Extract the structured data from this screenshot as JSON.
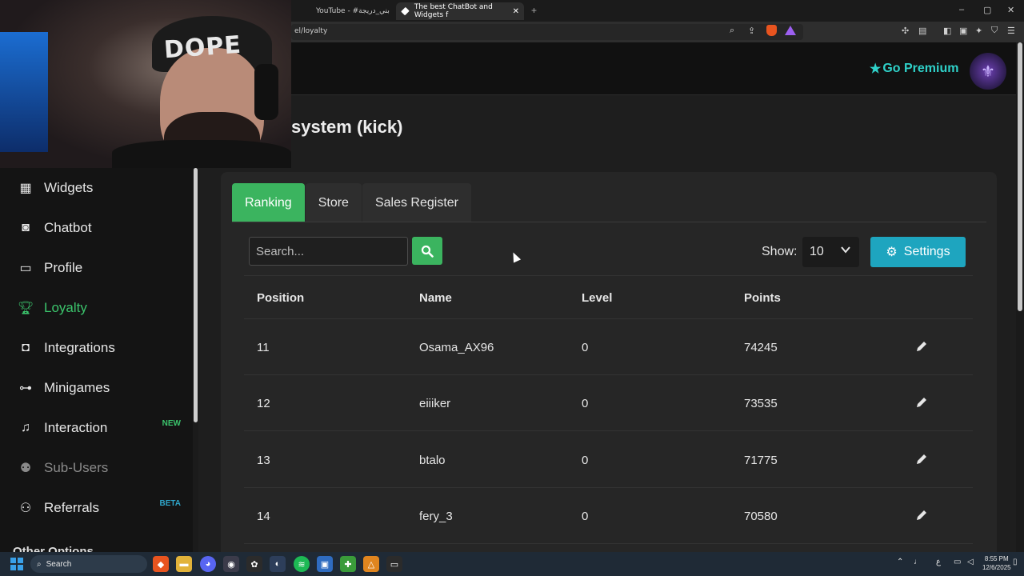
{
  "browser": {
    "tabs": [
      {
        "label": "YouTube - #بني_دريجة",
        "active": false
      },
      {
        "label": "The best ChatBot and Widgets f",
        "active": true
      }
    ],
    "tab_close": "✕",
    "new_tab": "+",
    "url": "el/loyalty",
    "window_controls": [
      "–",
      "▢",
      "✕"
    ]
  },
  "webcam": {
    "cap_text": "DOPE"
  },
  "header": {
    "premium_label": "Go Premium",
    "premium_icon": "star-icon",
    "accent": "#2fd1c9"
  },
  "page": {
    "title": "system (kick)"
  },
  "sidebar": {
    "items": [
      {
        "label": "Widgets",
        "icon": "grid-icon",
        "state": "normal"
      },
      {
        "label": "Chatbot",
        "icon": "robot-icon",
        "state": "normal"
      },
      {
        "label": "Profile",
        "icon": "id-card-icon",
        "state": "normal"
      },
      {
        "label": "Loyalty",
        "icon": "trophy-icon",
        "state": "active"
      },
      {
        "label": "Integrations",
        "icon": "discord-icon",
        "state": "normal"
      },
      {
        "label": "Minigames",
        "icon": "gamepad-icon",
        "state": "normal"
      },
      {
        "label": "Interaction",
        "icon": "music-icon",
        "state": "normal",
        "badge": "NEW"
      },
      {
        "label": "Sub-Users",
        "icon": "users-icon",
        "state": "disabled"
      },
      {
        "label": "Referrals",
        "icon": "people-icon",
        "state": "normal",
        "badge": "BETA"
      }
    ],
    "next_section": "Other Options",
    "active_color": "#3bc46c"
  },
  "tabs": [
    {
      "label": "Ranking",
      "active": true
    },
    {
      "label": "Store",
      "active": false
    },
    {
      "label": "Sales Register",
      "active": false
    }
  ],
  "toolbar": {
    "search_placeholder": "Search...",
    "show_label": "Show:",
    "show_value": "10",
    "settings_label": "Settings"
  },
  "table": {
    "columns": [
      "Position",
      "Name",
      "Level",
      "Points"
    ],
    "rows": [
      {
        "position": "11",
        "name": "Osama_AX96",
        "level": "0",
        "points": "74245"
      },
      {
        "position": "12",
        "name": "eiiiker",
        "level": "0",
        "points": "73535"
      },
      {
        "position": "13",
        "name": "btalo",
        "level": "0",
        "points": "71775"
      },
      {
        "position": "14",
        "name": "fery_3",
        "level": "0",
        "points": "70580"
      }
    ]
  },
  "taskbar": {
    "search_label": "Search",
    "tray_lang": "ع",
    "time": "8:55 PM",
    "date": "12/6/2025"
  },
  "colors": {
    "green": "#3bb45f",
    "teal": "#1ea5bf",
    "panel": "#262626"
  }
}
